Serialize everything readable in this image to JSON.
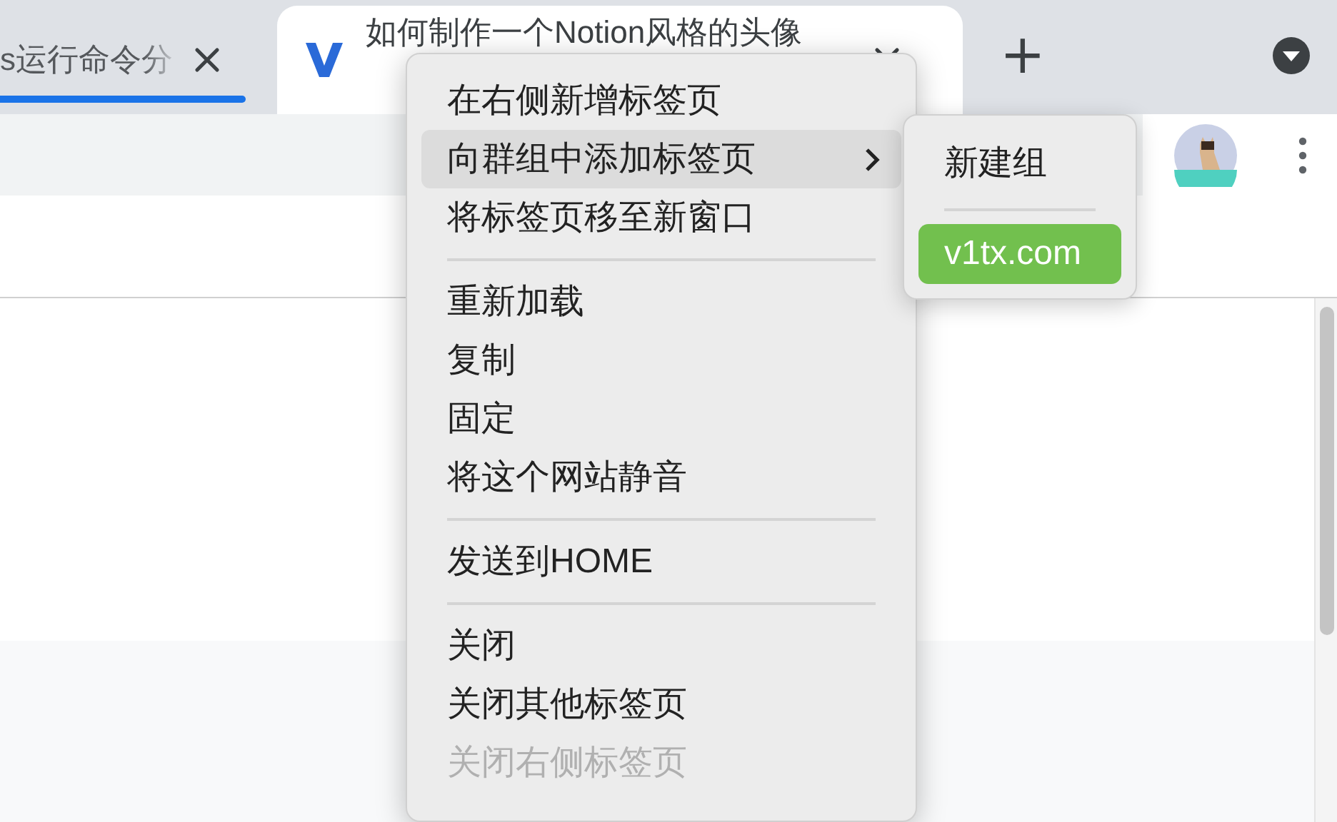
{
  "tabs": [
    {
      "title": "s运行命令分",
      "selected": false,
      "has_favicon": false
    },
    {
      "title": "如何制作一个Notion风格的头像",
      "selected": true,
      "has_favicon": true
    }
  ],
  "new_tab_button": "+",
  "context_menu": {
    "sections": [
      [
        {
          "label": "在右侧新增标签页",
          "highlighted": false,
          "has_submenu": false,
          "disabled": false
        },
        {
          "label": "向群组中添加标签页",
          "highlighted": true,
          "has_submenu": true,
          "disabled": false
        },
        {
          "label": "将标签页移至新窗口",
          "highlighted": false,
          "has_submenu": false,
          "disabled": false
        }
      ],
      [
        {
          "label": "重新加载",
          "highlighted": false,
          "has_submenu": false,
          "disabled": false
        },
        {
          "label": "复制",
          "highlighted": false,
          "has_submenu": false,
          "disabled": false
        },
        {
          "label": "固定",
          "highlighted": false,
          "has_submenu": false,
          "disabled": false
        },
        {
          "label": "将这个网站静音",
          "highlighted": false,
          "has_submenu": false,
          "disabled": false
        }
      ],
      [
        {
          "label": "发送到HOME",
          "highlighted": false,
          "has_submenu": false,
          "disabled": false
        }
      ],
      [
        {
          "label": "关闭",
          "highlighted": false,
          "has_submenu": false,
          "disabled": false
        },
        {
          "label": "关闭其他标签页",
          "highlighted": false,
          "has_submenu": false,
          "disabled": false
        },
        {
          "label": "关闭右侧标签页",
          "highlighted": false,
          "has_submenu": false,
          "disabled": true
        }
      ]
    ]
  },
  "submenu": {
    "new_group": "新建组",
    "groups": [
      {
        "label": "v1tx.com",
        "color": "#72c04e"
      }
    ]
  }
}
